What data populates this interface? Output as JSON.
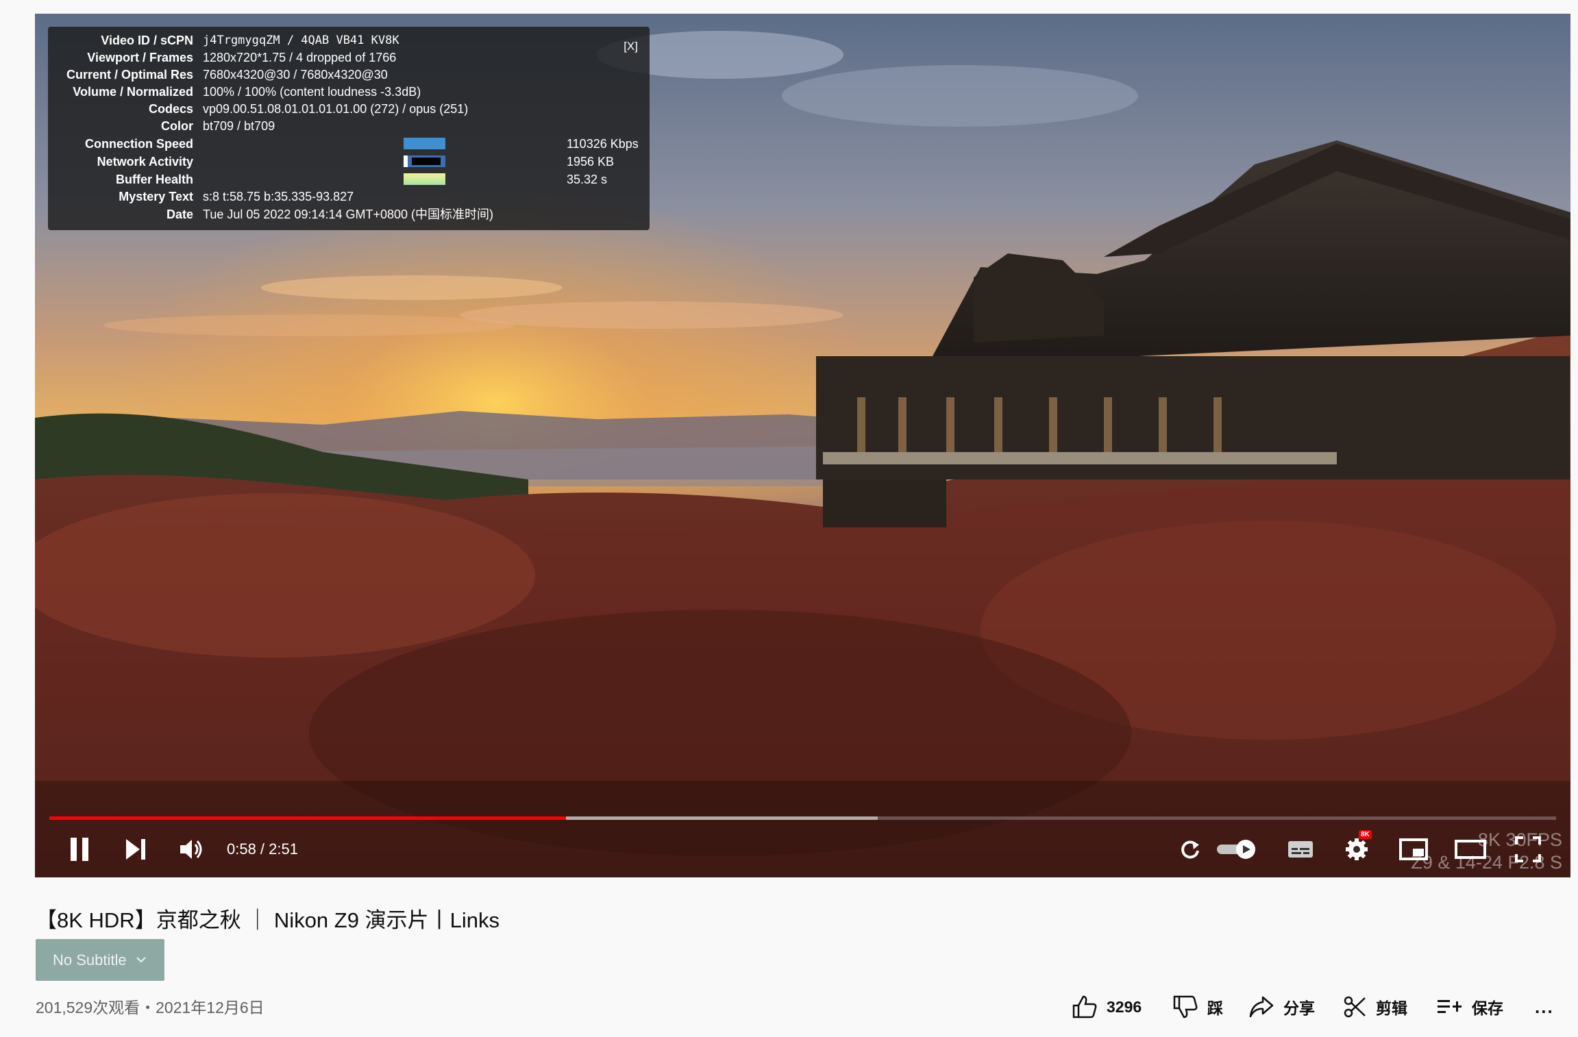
{
  "stats": {
    "close_label": "[X]",
    "rows": [
      {
        "label": "Video ID / sCPN",
        "value": "j4TrgmygqZM / 4QAB VB41 KV8K"
      },
      {
        "label": "Viewport / Frames",
        "value": "1280x720*1.75 / 4 dropped of 1766"
      },
      {
        "label": "Current / Optimal Res",
        "value": "7680x4320@30 / 7680x4320@30"
      },
      {
        "label": "Volume / Normalized",
        "value": "100% / 100% (content loudness -3.3dB)"
      },
      {
        "label": "Codecs",
        "value": "vp09.00.51.08.01.01.01.01.00 (272) / opus (251)"
      },
      {
        "label": "Color",
        "value": "bt709 / bt709"
      },
      {
        "label": "Connection Speed",
        "value": "110326 Kbps"
      },
      {
        "label": "Network Activity",
        "value": "1956 KB"
      },
      {
        "label": "Buffer Health",
        "value": "35.32 s"
      },
      {
        "label": "Mystery Text",
        "value": "s:8 t:58.75 b:35.335-93.827"
      },
      {
        "label": "Date",
        "value": "Tue Jul 05 2022 09:14:14 GMT+0800 (中国标准时间)"
      }
    ]
  },
  "player": {
    "time": "0:58 / 2:51",
    "watermark_line1": "8K 30FPS",
    "watermark_line2": "Z9 & 14-24 F2.8 S",
    "settings_badge": "8K",
    "progress_played": 0.343,
    "progress_buffered": 0.55,
    "accent": "#ff0000"
  },
  "video": {
    "title": "【8K HDR】京都之秋 ｜ Nikon Z9 演示片丨Links",
    "subtitle_button": "No Subtitle",
    "meta": "201,529次观看・2021年12月6日",
    "like_count": "3296",
    "dislike_label": "踩",
    "share_label": "分享",
    "clip_label": "剪辑",
    "save_label": "保存",
    "more_label": "..."
  }
}
